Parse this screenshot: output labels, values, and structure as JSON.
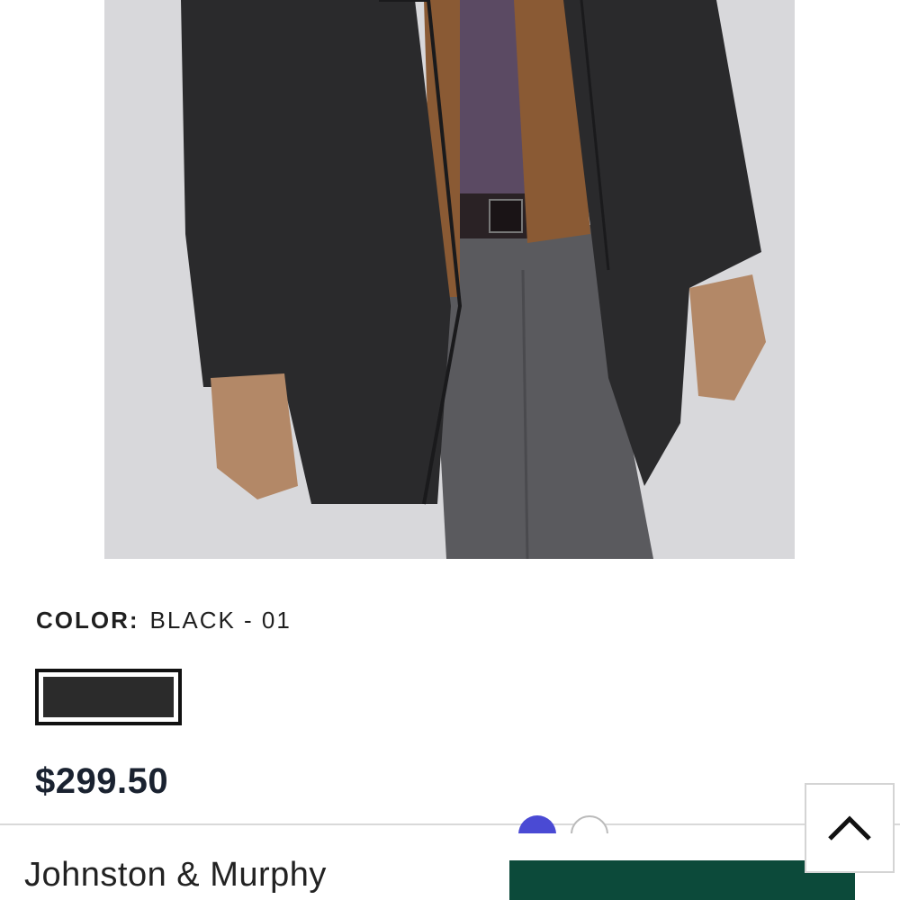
{
  "product": {
    "image_alt": "Man wearing black coat over brown vest and purple shirt",
    "color_label": "COLOR:",
    "color_value": "BLACK - 01",
    "swatch_color": "#2b2b2b",
    "price": "$299.50"
  },
  "sticky_bar": {
    "brand": "Johnston & Murphy",
    "button_color": "#0c4a3a"
  },
  "icons": {
    "back_to_top": "chevron-up-icon"
  },
  "colors": {
    "accent": "#4a4ad4",
    "price_text": "#1a2230"
  }
}
